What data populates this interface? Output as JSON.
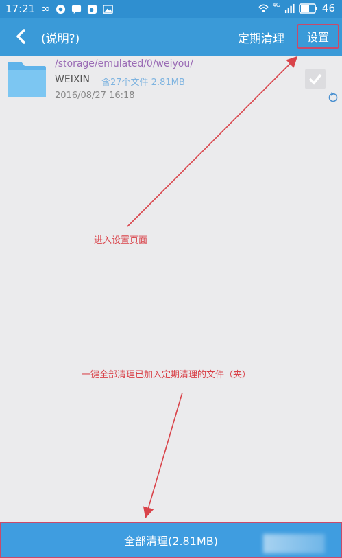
{
  "status_bar": {
    "time": "17:21",
    "network": "4G",
    "battery_level": "46"
  },
  "header": {
    "title": "(说明?)",
    "scheduled_clean": "定期清理",
    "settings": "设置"
  },
  "folder": {
    "path": "/storage/emulated/0/weiyou/",
    "name": "WEIXIN",
    "meta": "含27个文件 2.81MB",
    "date": "2016/08/27 16:18"
  },
  "annotations": {
    "settings_note": "进入设置页面",
    "clean_note": "一键全部清理已加入定期清理的文件（夹）"
  },
  "bottom": {
    "clean_all": "全部清理(2.81MB)"
  },
  "colors": {
    "header": "#3a9ad8",
    "status_bar": "#2f8fd0",
    "annotation": "#d9434a",
    "background": "#ebebed"
  }
}
